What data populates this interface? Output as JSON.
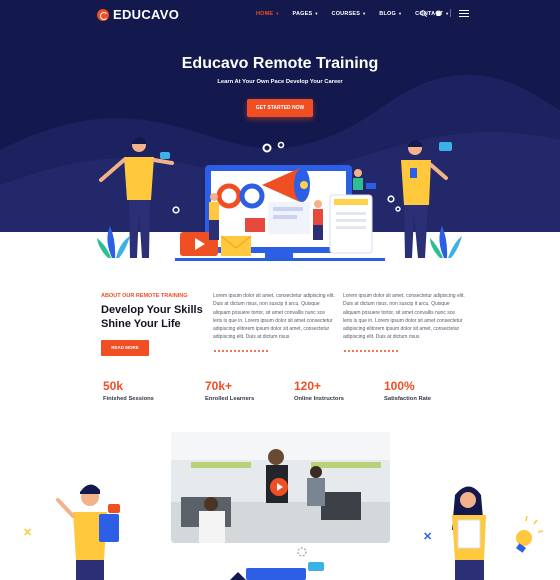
{
  "brand": {
    "name": "EDUCAVO",
    "accent": "#f04e23",
    "navy": "#13184d"
  },
  "nav": {
    "items": [
      {
        "label": "HOME",
        "active": true
      },
      {
        "label": "PAGES",
        "active": false
      },
      {
        "label": "COURSES",
        "active": false
      },
      {
        "label": "BLOG",
        "active": false
      },
      {
        "label": "CONTACT",
        "active": false
      }
    ],
    "icons": [
      "search-icon",
      "cart-icon",
      "menu-icon"
    ]
  },
  "hero": {
    "title": "Educavo Remote Training",
    "subtitle": "Learn At Your Own Pace Develop Your Career",
    "cta_label": "GET STARTED NOW"
  },
  "about": {
    "eyebrow": "ABOUT OUR REMOTE TRAINING",
    "title": "Develop Your Skills Shine Your Life",
    "readmore_label": "READ MORE",
    "paragraph_1": "Lorem ipsum dolor sit amet, consectetur adipiscing elit. Duis at dictum risus, non suscip it arcu. Quisque aliquam posuere tortor, sit amet convallis nunc sce leris is que in. Lorem ipsum dolor sit amet consectetur adipiscing elitorem ipsum dolor sit amet, consectetur adipiscing elit. Duis at dictum risus",
    "paragraph_2": "Lorem ipsum dolor sit amet, consectetur adipiscing elit. Duis at dictum risus, non suscip it arcu. Quisque aliquam posuere tortor, sit amet convallis nunc sce leris is que in. Lorem ipsum dolor sit amet consectetur adipiscing elitorem ipsum dolor sit amet, consectetur adipiscing elit. Duis at dictum risus"
  },
  "stats": [
    {
      "value": "50k",
      "label": "Finished Sessions"
    },
    {
      "value": "70k+",
      "label": "Enrolled Learners"
    },
    {
      "value": "120+",
      "label": "Online Instructors"
    },
    {
      "value": "100%",
      "label": "Satisfaction Rate"
    }
  ]
}
